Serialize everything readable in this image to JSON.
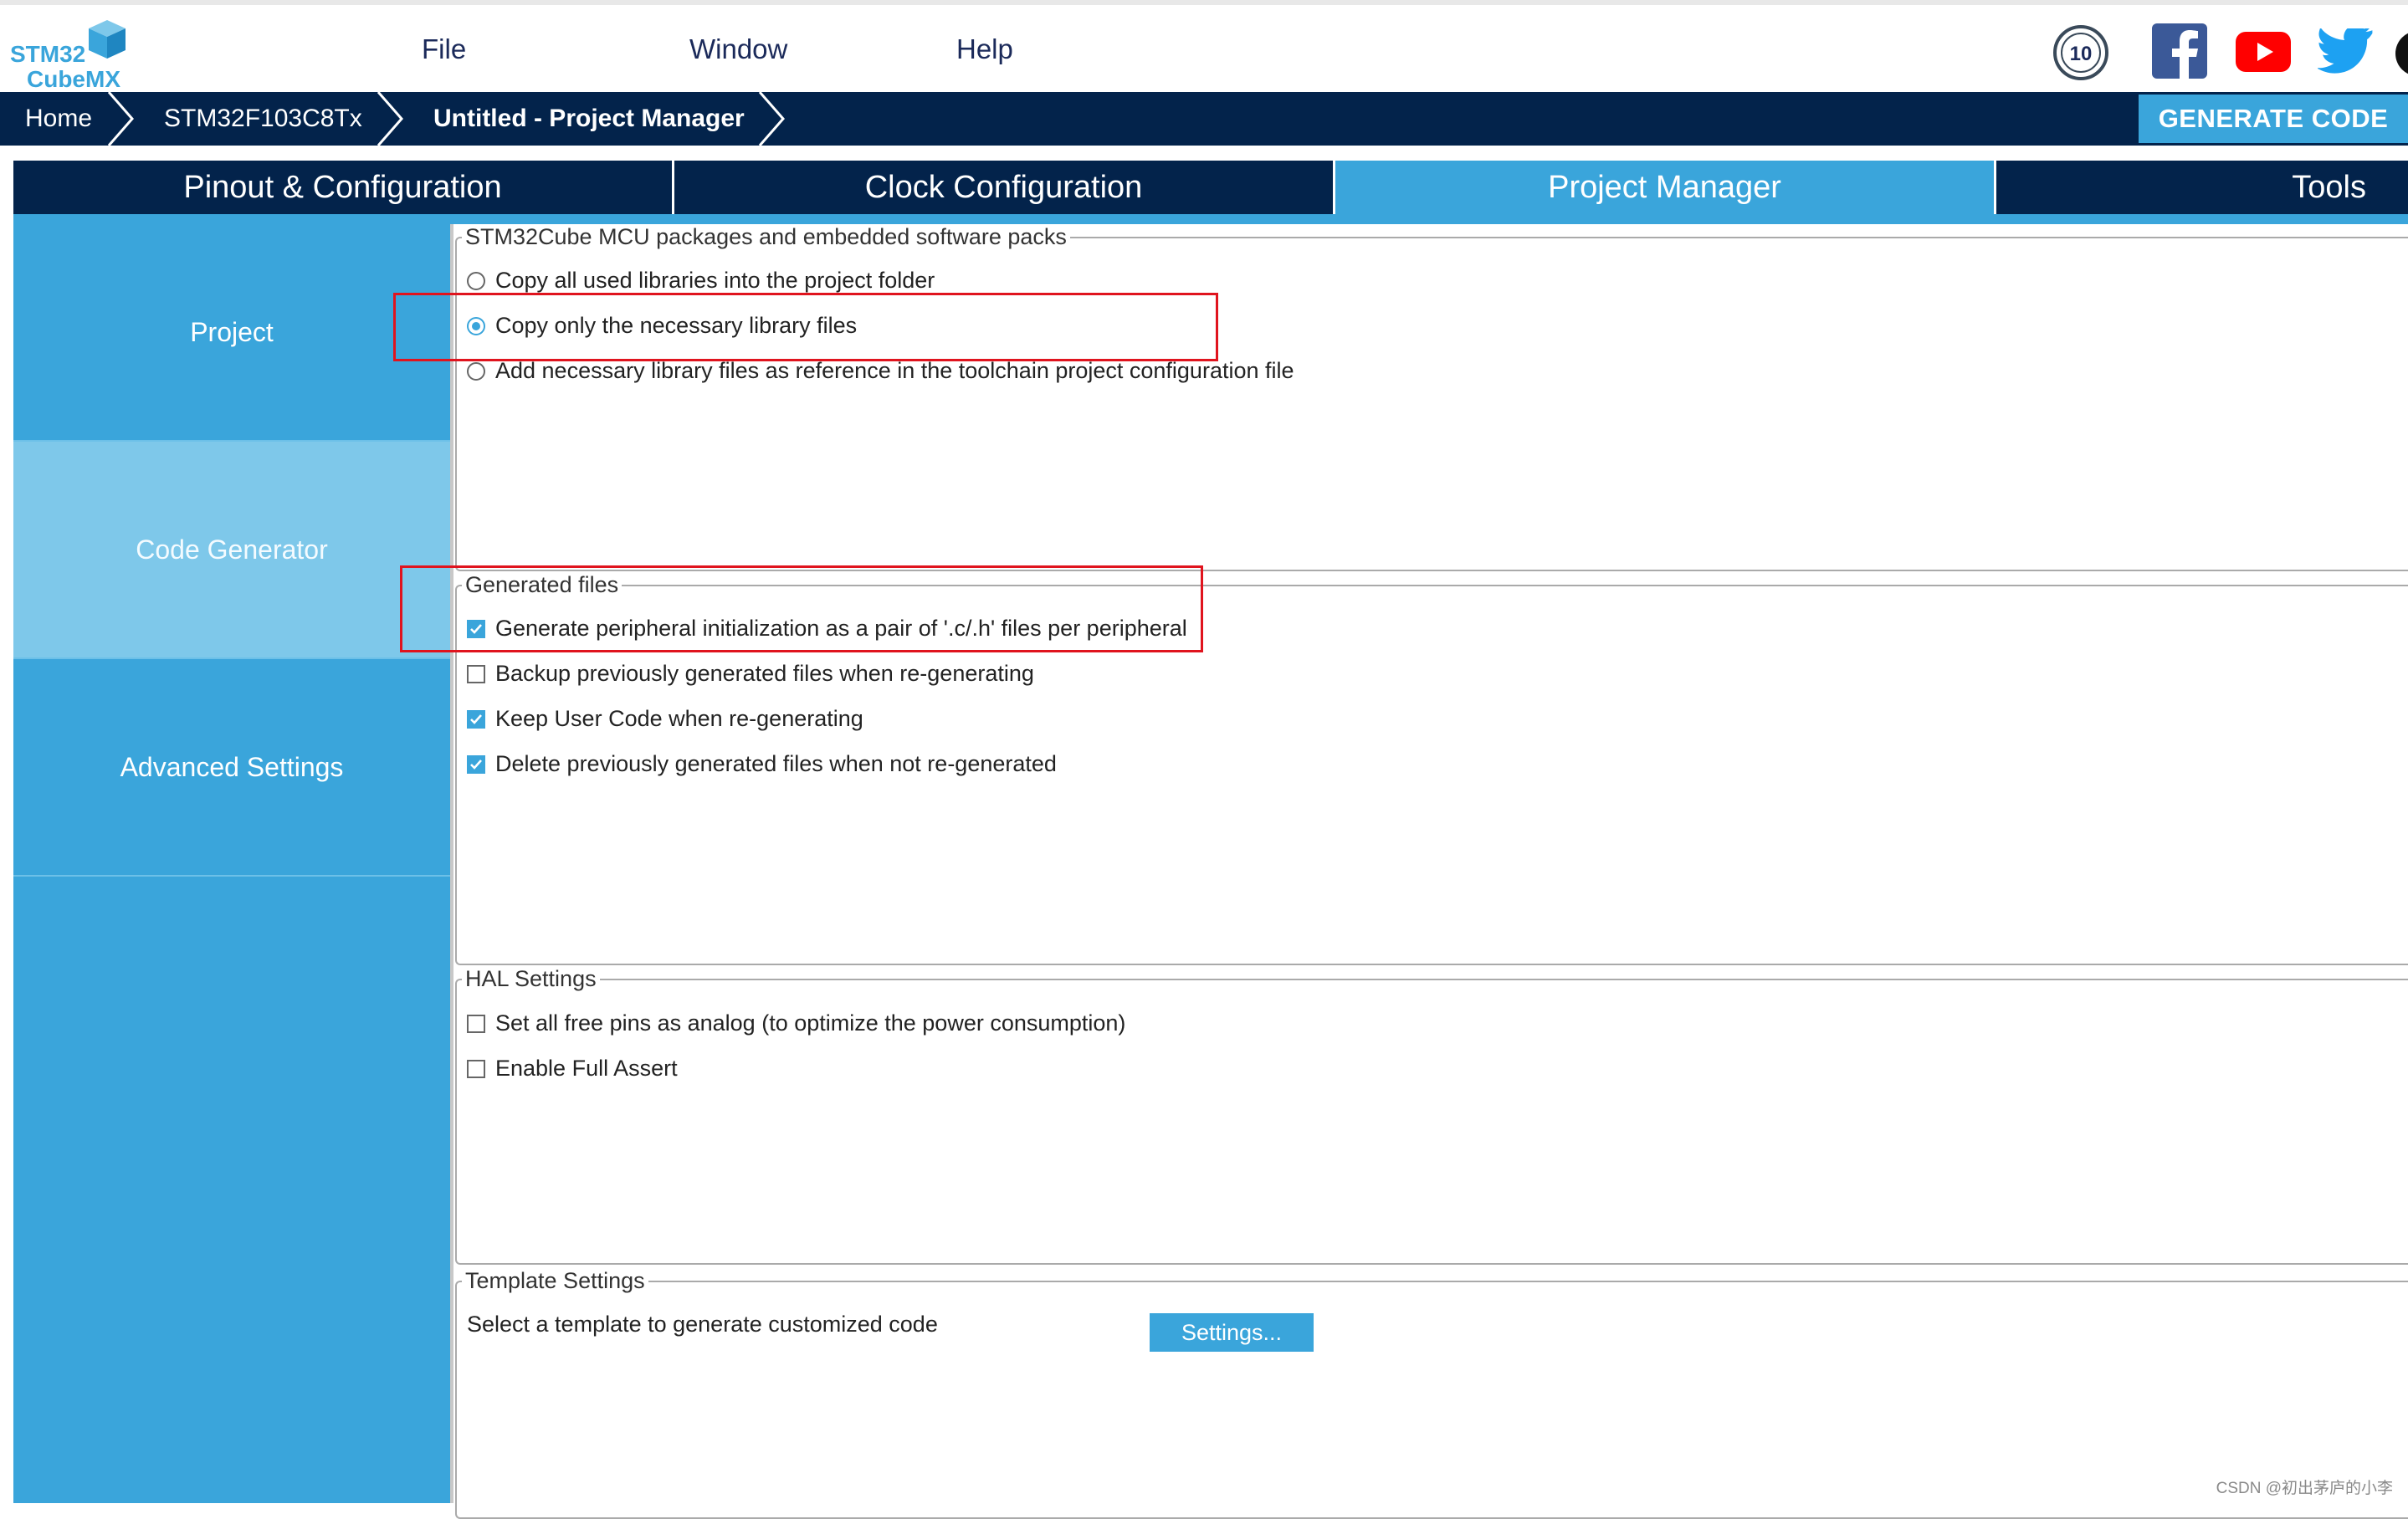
{
  "app": {
    "logo_line1": "STM32",
    "logo_line2": "CubeMX"
  },
  "menu": {
    "file": "File",
    "window": "Window",
    "help": "Help"
  },
  "social": {
    "anniversary_badge": "10",
    "icons": [
      "anniversary-badge-icon",
      "facebook-icon",
      "youtube-icon",
      "twitter-icon"
    ],
    "colors": {
      "facebook": "#3b5998",
      "youtube": "#ff0000",
      "twitter": "#1da1f2"
    }
  },
  "breadcrumb": {
    "home": "Home",
    "device": "STM32F103C8Tx",
    "current": "Untitled - Project Manager"
  },
  "generate_button": "GENERATE CODE",
  "tabs": [
    {
      "label": "Pinout & Configuration",
      "active": false
    },
    {
      "label": "Clock Configuration",
      "active": false
    },
    {
      "label": "Project Manager",
      "active": true
    },
    {
      "label": "Tools",
      "active": false
    }
  ],
  "sidenav": [
    {
      "label": "Project",
      "active": false
    },
    {
      "label": "Code Generator",
      "active": true
    },
    {
      "label": "Advanced Settings",
      "active": false
    }
  ],
  "groups": {
    "packages": {
      "legend": "STM32Cube MCU packages and embedded software packs",
      "options": [
        {
          "label": "Copy all used libraries into the project folder",
          "selected": false
        },
        {
          "label": "Copy only the necessary library files",
          "selected": true
        },
        {
          "label": "Add necessary library files as reference in the toolchain project configuration file",
          "selected": false
        }
      ]
    },
    "generated": {
      "legend": "Generated files",
      "options": [
        {
          "label": "Generate peripheral initialization as a pair of '.c/.h' files per peripheral",
          "checked": true
        },
        {
          "label": "Backup previously generated files when re-generating",
          "checked": false
        },
        {
          "label": "Keep User Code when re-generating",
          "checked": true
        },
        {
          "label": "Delete previously generated files when not re-generated",
          "checked": true
        }
      ]
    },
    "hal": {
      "legend": "HAL Settings",
      "options": [
        {
          "label": "Set all free pins as analog (to optimize the power consumption)",
          "checked": false
        },
        {
          "label": "Enable Full Assert",
          "checked": false
        }
      ]
    },
    "template": {
      "legend": "Template Settings",
      "description": "Select a template to generate customized code",
      "button": "Settings..."
    }
  },
  "colors": {
    "accent": "#3aa5db",
    "navy": "#03234b",
    "sidenav_active": "#7ec8ea",
    "annotation_red": "#e0141e"
  },
  "watermark": "CSDN @初出茅庐的小李"
}
